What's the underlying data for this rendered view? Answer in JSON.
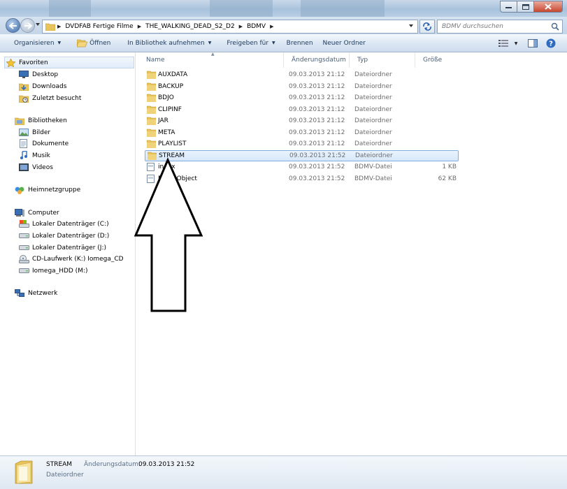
{
  "window": {
    "buttons": [
      "minimize",
      "maximize",
      "close"
    ]
  },
  "address": {
    "crumbs": [
      "DVDFAB Fertige Filme",
      "THE_WALKING_DEAD_S2_D2",
      "BDMV"
    ],
    "search_placeholder": "BDMV durchsuchen"
  },
  "toolbar": {
    "organize": "Organisieren",
    "open": "Öffnen",
    "include_library": "In Bibliothek aufnehmen",
    "share": "Freigeben für",
    "burn": "Brennen",
    "new_folder": "Neuer Ordner"
  },
  "sidebar": {
    "favorites": {
      "label": "Favoriten",
      "items": [
        "Desktop",
        "Downloads",
        "Zuletzt besucht"
      ]
    },
    "libraries": {
      "label": "Bibliotheken",
      "items": [
        "Bilder",
        "Dokumente",
        "Musik",
        "Videos"
      ]
    },
    "homegroup": "Heimnetzgruppe",
    "computer": {
      "label": "Computer",
      "items": [
        "Lokaler Datenträger (C:)",
        "Lokaler Datenträger (D:)",
        "Lokaler Datenträger (J:)",
        "CD-Laufwerk (K:) Iomega_CD",
        "Iomega_HDD (M:)"
      ]
    },
    "network": "Netzwerk"
  },
  "columns": {
    "name": "Name",
    "date": "Änderungsdatum",
    "type": "Typ",
    "size": "Größe"
  },
  "files": [
    {
      "name": "AUXDATA",
      "date": "09.03.2013 21:12",
      "type": "Dateiordner",
      "size": "",
      "kind": "folder"
    },
    {
      "name": "BACKUP",
      "date": "09.03.2013 21:12",
      "type": "Dateiordner",
      "size": "",
      "kind": "folder"
    },
    {
      "name": "BDJO",
      "date": "09.03.2013 21:12",
      "type": "Dateiordner",
      "size": "",
      "kind": "folder"
    },
    {
      "name": "CLIPINF",
      "date": "09.03.2013 21:12",
      "type": "Dateiordner",
      "size": "",
      "kind": "folder"
    },
    {
      "name": "JAR",
      "date": "09.03.2013 21:12",
      "type": "Dateiordner",
      "size": "",
      "kind": "folder"
    },
    {
      "name": "META",
      "date": "09.03.2013 21:12",
      "type": "Dateiordner",
      "size": "",
      "kind": "folder"
    },
    {
      "name": "PLAYLIST",
      "date": "09.03.2013 21:12",
      "type": "Dateiordner",
      "size": "",
      "kind": "folder"
    },
    {
      "name": "STREAM",
      "date": "09.03.2013 21:52",
      "type": "Dateiordner",
      "size": "",
      "kind": "folder",
      "selected": true
    },
    {
      "name": "index",
      "date": "09.03.2013 21:52",
      "type": "BDMV-Datei",
      "size": "1 KB",
      "kind": "file"
    },
    {
      "name": "MovieObject",
      "date": "09.03.2013 21:52",
      "type": "BDMV-Datei",
      "size": "62 KB",
      "kind": "file"
    }
  ],
  "details": {
    "name": "STREAM",
    "date_label": "Änderungsdatum:",
    "date_value": "09.03.2013 21:52",
    "type": "Dateiordner"
  },
  "colors": {
    "folder": "#e8c55a",
    "selection": "#d6e8fc",
    "link_blue": "#1e395b"
  },
  "icons": [
    "back-arrow-icon",
    "forward-arrow-icon",
    "folder-icon",
    "refresh-icon",
    "search-icon",
    "star-icon",
    "desktop-icon",
    "downloads-icon",
    "recent-icon",
    "library-icon",
    "pictures-icon",
    "documents-icon",
    "music-icon",
    "videos-icon",
    "homegroup-icon",
    "computer-icon",
    "drive-icon",
    "cd-drive-icon",
    "network-icon",
    "file-icon",
    "views-icon",
    "preview-pane-icon",
    "help-icon"
  ]
}
